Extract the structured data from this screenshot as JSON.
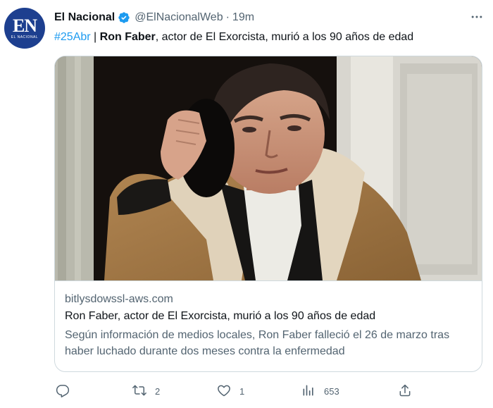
{
  "tweet": {
    "avatar_monogram": "EN",
    "avatar_sublabel": "EL NACIONAL",
    "author_name": "El Nacional",
    "handle": "@ElNacionalWeb",
    "separator": "·",
    "time": "19m",
    "text_hashtag": "#25Abr",
    "text_separator": " | ",
    "text_bold": "Ron Faber",
    "text_rest": ", actor de El Exorcista, murió a los 90 años de edad"
  },
  "card": {
    "domain": "bitlysdowssl-aws.com",
    "title": "Ron Faber, actor de El Exorcista, murió a los 90 años de edad",
    "description": "Según información de medios locales, Ron Faber falleció el 26 de marzo tras haber luchado durante dos meses contra la enfermedad"
  },
  "actions": {
    "retweets": "2",
    "likes": "1",
    "views": "653"
  },
  "icons": [
    "verified-badge-icon",
    "more-options-icon",
    "reply-icon",
    "retweet-icon",
    "like-icon",
    "views-icon",
    "share-icon"
  ],
  "colors": {
    "link_blue": "#1d9bf0",
    "secondary_text": "#536471",
    "border": "#cfd9de",
    "brand_navy": "#1d3f8f"
  }
}
